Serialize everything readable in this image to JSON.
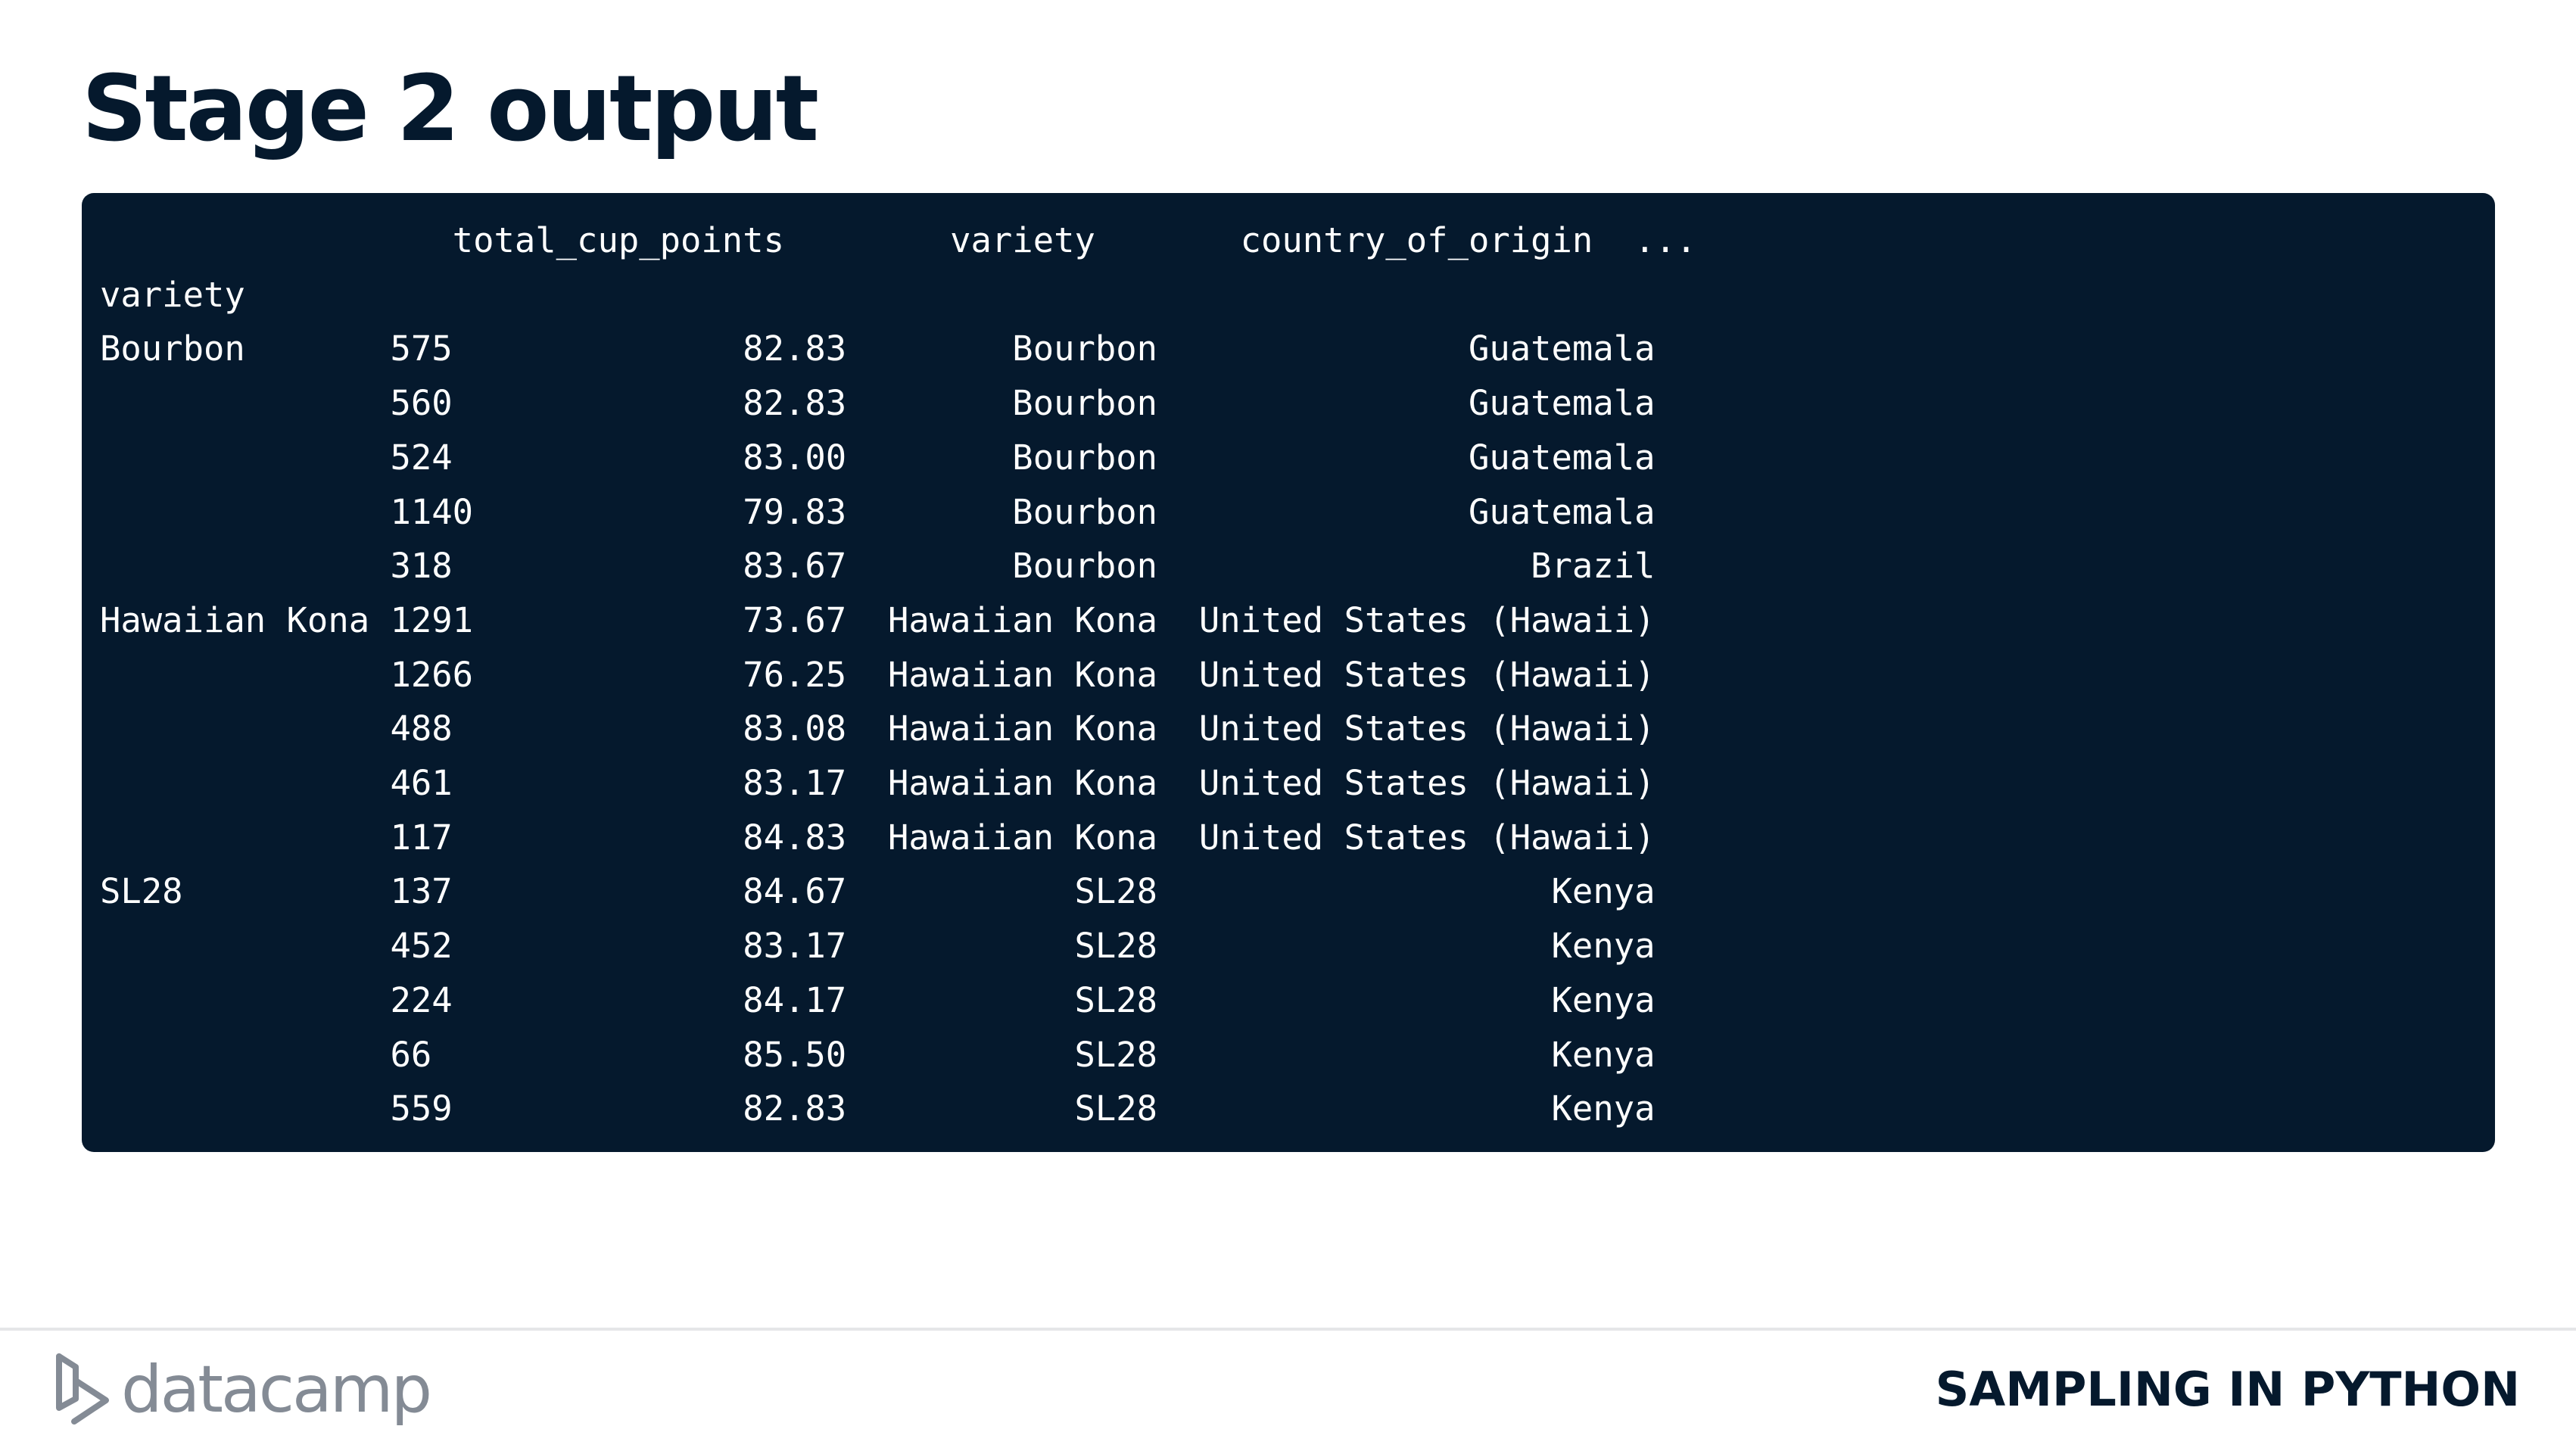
{
  "slide": {
    "title": "Stage 2 output"
  },
  "code_output": {
    "lines": [
      "                 total_cup_points        variety       country_of_origin  ...",
      "variety",
      "Bourbon       575              82.83        Bourbon               Guatemala",
      "              560              82.83        Bourbon               Guatemala",
      "              524              83.00        Bourbon               Guatemala",
      "              1140             79.83        Bourbon               Guatemala",
      "              318              83.67        Bourbon                  Brazil",
      "Hawaiian Kona 1291             73.67  Hawaiian Kona  United States (Hawaii)",
      "              1266             76.25  Hawaiian Kona  United States (Hawaii)",
      "              488              83.08  Hawaiian Kona  United States (Hawaii)",
      "              461              83.17  Hawaiian Kona  United States (Hawaii)",
      "              117              84.83  Hawaiian Kona  United States (Hawaii)",
      "SL28          137              84.67           SL28                   Kenya",
      "              452              83.17           SL28                   Kenya",
      "              224              84.17           SL28                   Kenya",
      "              66               85.50           SL28                   Kenya",
      "              559              82.83           SL28                   Kenya"
    ]
  },
  "footer": {
    "logo_text": "datacamp",
    "logo_icon": "datacamp-logo-icon",
    "course_name": "SAMPLING IN PYTHON"
  },
  "colors": {
    "navy": "#05192d",
    "logo_gray": "#848b95",
    "code_text": "#ffffff",
    "background": "#ffffff"
  }
}
